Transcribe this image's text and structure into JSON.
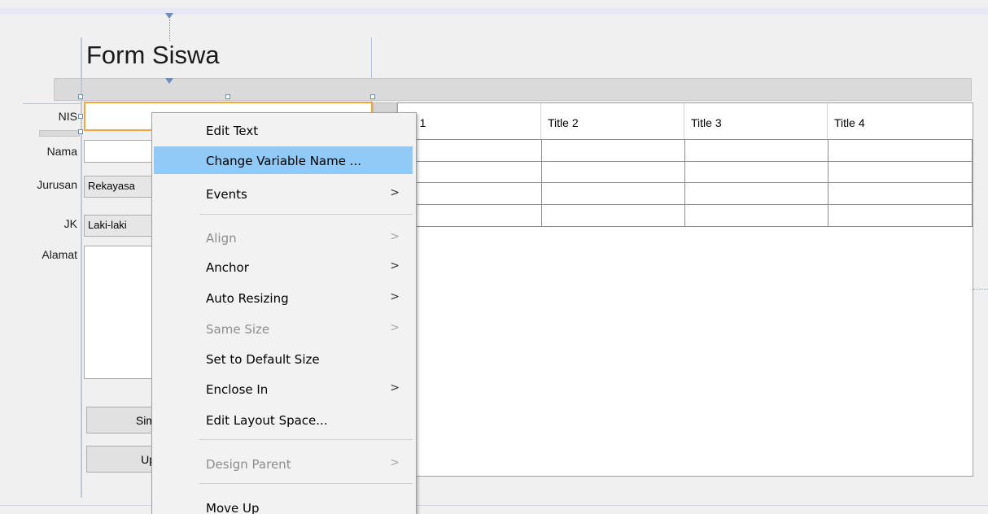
{
  "form": {
    "title": "Form Siswa",
    "labels": {
      "nis": "NIS",
      "nama": "Nama",
      "jurusan": "Jurusan",
      "jk": "JK",
      "alamat": "Alamat"
    },
    "combos": {
      "jurusan_value": "Rekayasa",
      "jk_value": "Laki-laki"
    },
    "buttons": {
      "simpan_visible": "Sim",
      "update_visible": "Up"
    }
  },
  "table": {
    "columns": [
      "Title 1",
      "Title 2",
      "Title 3",
      "Title 4"
    ],
    "visible_first_header": "tle 1"
  },
  "context_menu": {
    "items": [
      {
        "label": "Edit Text",
        "enabled": true,
        "submenu": false
      },
      {
        "label": "Change Variable Name ...",
        "enabled": true,
        "submenu": false,
        "highlighted": true
      },
      {
        "label": "Events",
        "enabled": true,
        "submenu": true
      },
      {
        "label": "Align",
        "enabled": false,
        "submenu": true
      },
      {
        "label": "Anchor",
        "enabled": true,
        "submenu": true
      },
      {
        "label": "Auto Resizing",
        "enabled": true,
        "submenu": true
      },
      {
        "label": "Same Size",
        "enabled": false,
        "submenu": true
      },
      {
        "label": "Set to Default Size",
        "enabled": true,
        "submenu": false
      },
      {
        "label": "Enclose In",
        "enabled": true,
        "submenu": true
      },
      {
        "label": "Edit Layout Space...",
        "enabled": true,
        "submenu": false
      },
      {
        "label": "Design Parent",
        "enabled": false,
        "submenu": true
      },
      {
        "label": "Move Up",
        "enabled": true,
        "submenu": false
      }
    ],
    "submenu_arrow": ">"
  },
  "colors": {
    "selection_border": "#f0a83a",
    "menu_highlight": "#91c9f7",
    "disabled_text": "#8d8d8d",
    "guide": "#6f8db4"
  },
  "icons": {
    "submenu_arrow": "chevron-right-icon",
    "anchor": "anchor-triangle-icon",
    "resize_handle": "resize-handle-icon"
  }
}
